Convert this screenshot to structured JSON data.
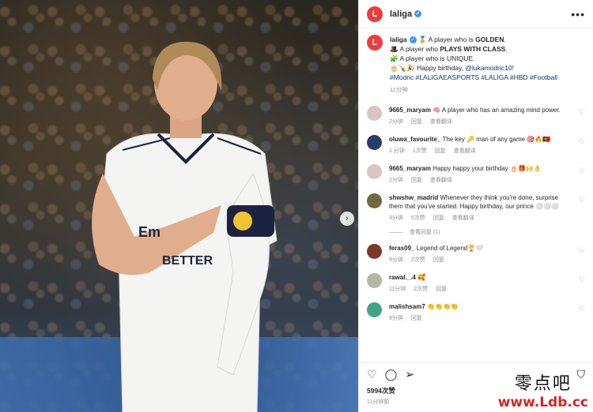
{
  "account": {
    "username": "laliga",
    "logo_glyph": "L"
  },
  "caption": {
    "line1_prefix": "🏅 A player who is ",
    "line1_bold": "GOLDEN",
    "line1_suffix": ".",
    "line2_prefix": "🎩 A player who ",
    "line2_bold": "PLAYS WITH CLASS",
    "line2_suffix": ".",
    "line3": "🧩 A player who is UNIQUE.",
    "birthday_prefix": "🎂🍾🎉 Happy birthday, ",
    "birthday_mention": "@lukamodric10!",
    "hashtags": "#Modric #LALIGAEASPORTS #LALIGA #HBD #Football",
    "time": "11分钟"
  },
  "comments": [
    {
      "user": "9665_maryam",
      "text": "🧠 A player who has an amazing mind power.",
      "time": "2分钟",
      "likes": "",
      "reply": "回复",
      "translate": "查看翻译",
      "avatar_color": "#d9c6c0"
    },
    {
      "user": "oluwa_favourite_",
      "text": "The key 🔑 man of any game 🎯🔥🇵🇹",
      "time": "1 分钟",
      "likes": "1次赞",
      "reply": "回复",
      "translate": "查看翻译",
      "avatar_color": "#2c3d6b"
    },
    {
      "user": "9665_maryam",
      "text": "Happy happy your birthday 🎂🎁🙌👌",
      "time": "2分钟",
      "likes": "",
      "reply": "回复",
      "translate": "查看翻译",
      "avatar_color": "#d9c6c0"
    },
    {
      "user": "shwshw_madrid",
      "text": "Whenever they think you're done, surprise them that you've started. Happy birthday, our prince ⚪⚪⚪",
      "time": "3分钟",
      "likes": "5次赞",
      "reply": "回复",
      "translate": "查看翻译",
      "avatar_color": "#6c6a3e"
    },
    {
      "user": "feras09_",
      "text": "Legend of Legend🏆🤍",
      "time": "9分钟",
      "likes": "2次赞",
      "reply": "回复",
      "translate": "",
      "avatar_color": "#7a3a2e"
    },
    {
      "user": "rawal._.4",
      "text": "🥰",
      "time": "11分钟",
      "likes": "2次赞",
      "reply": "回复",
      "translate": "",
      "avatar_color": "#b3b8a0"
    },
    {
      "user": "malishsam7",
      "text": "👏👏👏👏",
      "time": "9分钟",
      "likes": "",
      "reply": "回复",
      "translate": "",
      "avatar_color": "#3fa686"
    }
  ],
  "view_replies": "查看回复 (1)",
  "likes_count": "5994次赞",
  "post_time": "11分钟前",
  "watermark": {
    "line1": "零点吧",
    "line2": "www.Ldb.cc"
  },
  "colors": {
    "brand": "#ee3b3b",
    "link": "#00376b",
    "meta": "#8e8e8e"
  }
}
